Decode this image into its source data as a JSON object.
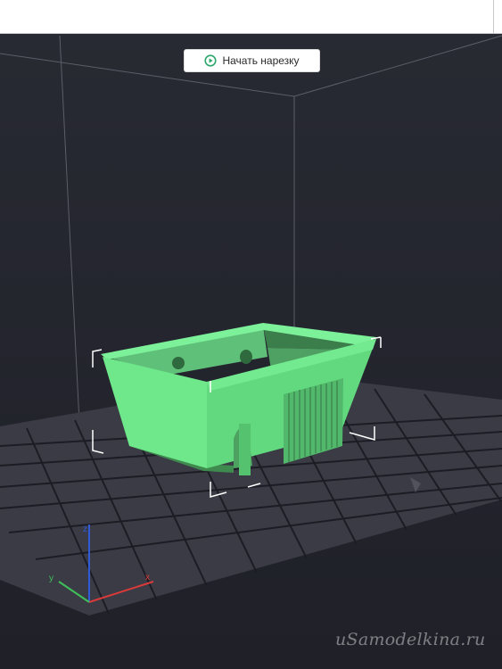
{
  "toolbar": {
    "slice_button_label": "Начать нарезку",
    "slice_button_icon": "play-circle-icon",
    "accent_color": "#2aa86b"
  },
  "viewport": {
    "model_color": "#6ee88a",
    "bed_color": "#3a3b44",
    "axis_colors": {
      "x": "#d93a3a",
      "y": "#3fbf5a",
      "z": "#2f5bd9"
    },
    "axis_labels": {
      "x": "x",
      "y": "y",
      "z": "z"
    }
  },
  "watermark": "uSamodelkina.ru"
}
